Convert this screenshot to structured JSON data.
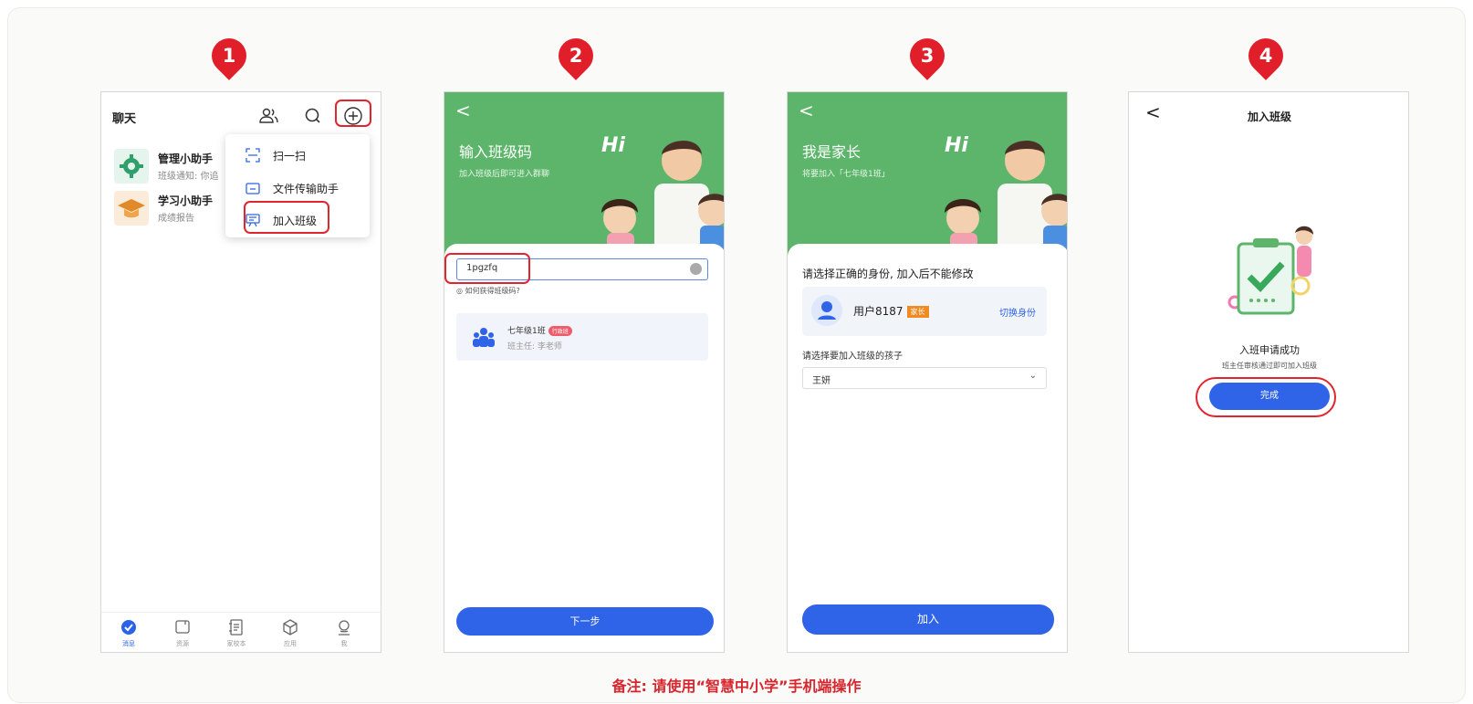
{
  "steps": [
    {
      "number": "1"
    },
    {
      "number": "2"
    },
    {
      "number": "3"
    },
    {
      "number": "4"
    }
  ],
  "phone1": {
    "title": "聊天",
    "header_icons": [
      "contacts-icon",
      "search-icon",
      "add-icon"
    ],
    "chats": [
      {
        "name": "管理小助手",
        "preview": "班级通知: 你追",
        "icon": "gear-icon",
        "color": "#2fa06a"
      },
      {
        "name": "学习小助手",
        "preview": "成绩报告",
        "icon": "graduation-cap-icon",
        "color": "#e08a2a"
      }
    ],
    "menu": [
      {
        "label": "扫一扫",
        "icon": "scan-icon"
      },
      {
        "label": "文件传输助手",
        "icon": "folder-icon"
      },
      {
        "label": "加入班级",
        "icon": "class-icon"
      }
    ],
    "tabs": [
      {
        "label": "消息",
        "icon": "message-icon",
        "active": true
      },
      {
        "label": "资源",
        "icon": "resource-icon",
        "active": false
      },
      {
        "label": "家校本",
        "icon": "notebook-icon",
        "active": false
      },
      {
        "label": "应用",
        "icon": "apps-icon",
        "active": false
      },
      {
        "label": "我",
        "icon": "profile-icon",
        "active": false
      }
    ]
  },
  "phone2": {
    "back": "<",
    "title": "输入班级码",
    "subtitle": "加入班级后即可进入群聊",
    "hi": "Hi",
    "input_value": "1pgzfq",
    "how_text": "如何获得班级码?",
    "class_name": "七年级1班",
    "class_tag": "行政班",
    "class_teacher": "班主任: 李老师",
    "next_button": "下一步"
  },
  "phone3": {
    "back": "<",
    "title": "我是家长",
    "subtitle": "将要加入「七年级1班」",
    "hi": "Hi",
    "question": "请选择正确的身份, 加入后不能修改",
    "user_name": "用户8187",
    "role": "家长",
    "switch_label": "切换身份",
    "child_label": "请选择要加入班级的孩子",
    "child_value": "王妍",
    "join_button": "加入"
  },
  "phone4": {
    "back": "<",
    "title": "加入班级",
    "success": "入班申请成功",
    "sub": "班主任审核通过即可加入班级",
    "done_button": "完成"
  },
  "footnote": "备注: 请使用“智慧中小学”手机端操作",
  "colors": {
    "accent": "#2f63e8",
    "red": "#e01f2a",
    "green": "#5cb56a"
  }
}
